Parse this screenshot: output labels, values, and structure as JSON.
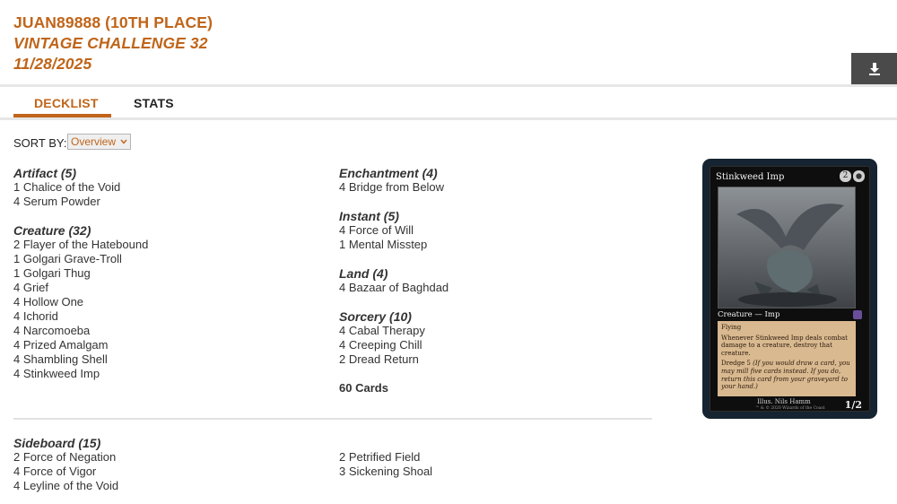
{
  "header": {
    "player": "JUAN89888 (10TH PLACE)",
    "event": "VINTAGE CHALLENGE 32",
    "date": "11/28/2025"
  },
  "download": {
    "icon": "download-icon"
  },
  "tabs": [
    {
      "label": "DECKLIST",
      "active": true
    },
    {
      "label": "STATS",
      "active": false
    }
  ],
  "sort": {
    "label": "SORT BY:",
    "value": "Overview"
  },
  "main": {
    "artifact": {
      "title": "Artifact (5)",
      "cards": [
        "1 Chalice of the Void",
        "4 Serum Powder"
      ]
    },
    "creature": {
      "title": "Creature (32)",
      "cards": [
        "2 Flayer of the Hatebound",
        "1 Golgari Grave-Troll",
        "1 Golgari Thug",
        "4 Grief",
        "4 Hollow One",
        "4 Ichorid",
        "4 Narcomoeba",
        "4 Prized Amalgam",
        "4 Shambling Shell",
        "4 Stinkweed Imp"
      ]
    },
    "enchantment": {
      "title": "Enchantment (4)",
      "cards": [
        "4 Bridge from Below"
      ]
    },
    "instant": {
      "title": "Instant (5)",
      "cards": [
        "4 Force of Will",
        "1 Mental Misstep"
      ]
    },
    "land": {
      "title": "Land (4)",
      "cards": [
        "4 Bazaar of Baghdad"
      ]
    },
    "sorcery": {
      "title": "Sorcery (10)",
      "cards": [
        "4 Cabal Therapy",
        "4 Creeping Chill",
        "2 Dread Return"
      ]
    },
    "total": "60 Cards"
  },
  "sideboard": {
    "title": "Sideboard (15)",
    "left": [
      "2 Force of Negation",
      "4 Force of Vigor",
      "4 Leyline of the Void"
    ],
    "right": [
      "2 Petrified Field",
      "3 Sickening Shoal"
    ]
  },
  "card_preview": {
    "name": "Stinkweed Imp",
    "cost_generic": "2",
    "type": "Creature — Imp",
    "ability1": "Flying",
    "ability2": "Whenever Stinkweed Imp deals combat damage to a creature, destroy that creature.",
    "ability3": "Dredge 5",
    "reminder": "(If you would draw a card, you may mill five cards instead. If you do, return this card from your graveyard to your hand.)",
    "illus": "Illus. Nils Hamm",
    "copyright": "™ & © 2020 Wizards of the Coast",
    "pt": "1/2",
    "frame_color": "#152430",
    "accent": "#c0651a"
  }
}
